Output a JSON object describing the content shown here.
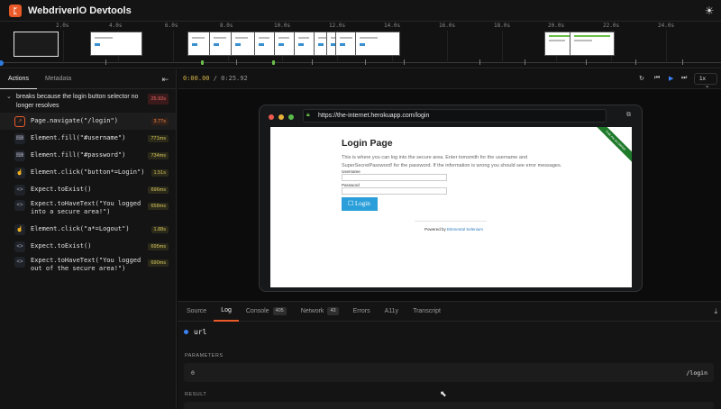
{
  "header": {
    "title": "WebdriverIO Devtools",
    "logo_icon": "wdio-logo-icon",
    "theme_icon": "sun-icon"
  },
  "timeline": {
    "ticks": [
      "2.0s",
      "4.0s",
      "6.0s",
      "8.0s",
      "10.0s",
      "12.0s",
      "14.0s",
      "16.0s",
      "18.0s",
      "20.0s",
      "22.0s",
      "24.0s"
    ]
  },
  "sidebar": {
    "tabs": [
      "Actions",
      "Metadata"
    ],
    "collapse_icon": "collapse-left-icon",
    "group": {
      "title": "breaks because the login button selector no longer resolves",
      "duration": "25.92s"
    },
    "actions": [
      {
        "icon": "navigate-icon",
        "label": "Page.navigate(\"/login\")",
        "duration": "3.77s"
      },
      {
        "icon": "keyboard-icon",
        "label": "Element.fill(\"#username\")",
        "duration": "771ms"
      },
      {
        "icon": "keyboard-icon",
        "label": "Element.fill(\"#password\")",
        "duration": "734ms"
      },
      {
        "icon": "click-icon",
        "label": "Element.click(\"button*=Login\")",
        "duration": "1.51s"
      },
      {
        "icon": "code-icon",
        "label": "Expect.toExist()",
        "duration": "696ms"
      },
      {
        "icon": "code-icon",
        "label": "Expect.toHaveText(\"You logged into a secure area!\")",
        "duration": "658ms"
      },
      {
        "icon": "click-icon",
        "label": "Element.click(\"a*=Logout\")",
        "duration": "1.88s"
      },
      {
        "icon": "code-icon",
        "label": "Expect.toExist()",
        "duration": "695ms"
      },
      {
        "icon": "code-icon",
        "label": "Expect.toHaveText(\"You logged out of the secure area!\")",
        "duration": "690ms"
      }
    ]
  },
  "playback": {
    "current": "0:00.00",
    "total": "0:25.92",
    "speed": "1x"
  },
  "browser": {
    "url": "https://the-internet.herokuapp.com/login",
    "page": {
      "title": "Login Page",
      "description": "This is where you can log into the secure area. Enter tomsmith for the username and SuperSecretPassword! for the password. If the information is wrong you should see error messages.",
      "username_label": "Username",
      "password_label": "Password",
      "login_button": "Login",
      "footer_prefix": "Powered by",
      "footer_link": "Elemental Selenium",
      "ribbon": "Fork me on GitHub"
    }
  },
  "bottom": {
    "tabs": [
      {
        "label": "Source",
        "badge": ""
      },
      {
        "label": "Log",
        "badge": ""
      },
      {
        "label": "Console",
        "badge": "405"
      },
      {
        "label": "Network",
        "badge": "43"
      },
      {
        "label": "Errors",
        "badge": ""
      },
      {
        "label": "A11y",
        "badge": ""
      },
      {
        "label": "Transcript",
        "badge": ""
      }
    ],
    "active_tab": "Log",
    "command": "url",
    "parameters_label": "PARAMETERS",
    "param_key": "0",
    "param_value": "/login",
    "result_label": "RESULT"
  },
  "colors": {
    "accent": "#ea5a29",
    "duration_warn": "#d4c55a",
    "duration_error": "#f06a6a",
    "link": "#3b82f6"
  }
}
